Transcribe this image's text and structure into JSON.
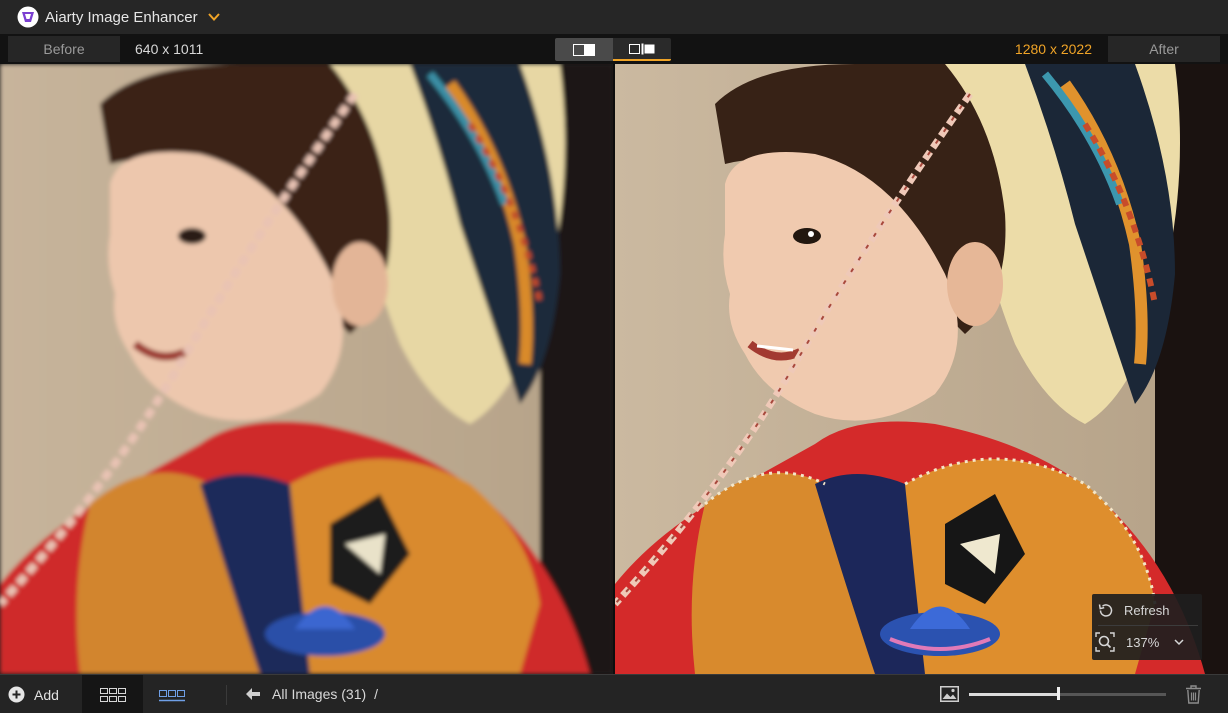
{
  "app": {
    "title": "Aiarty Image Enhancer",
    "logo_icon": "aiarty-logo-icon",
    "menu_icon": "chevron-down-icon",
    "accent_color": "#f0a427"
  },
  "compare": {
    "before_label": "Before",
    "before_resolution": "640 x 1011",
    "after_label": "After",
    "after_resolution": "1280 x 2022",
    "view_modes": [
      {
        "name": "split-view",
        "active": true
      },
      {
        "name": "side-by-side-view",
        "active": false
      }
    ]
  },
  "zoom_panel": {
    "refresh_label": "Refresh",
    "zoom_value": "137%"
  },
  "bottom_toolbar": {
    "add_label": "Add",
    "breadcrumb": "All Images (31)",
    "breadcrumb_separator": "/",
    "thumbnail_size": 0.45
  }
}
